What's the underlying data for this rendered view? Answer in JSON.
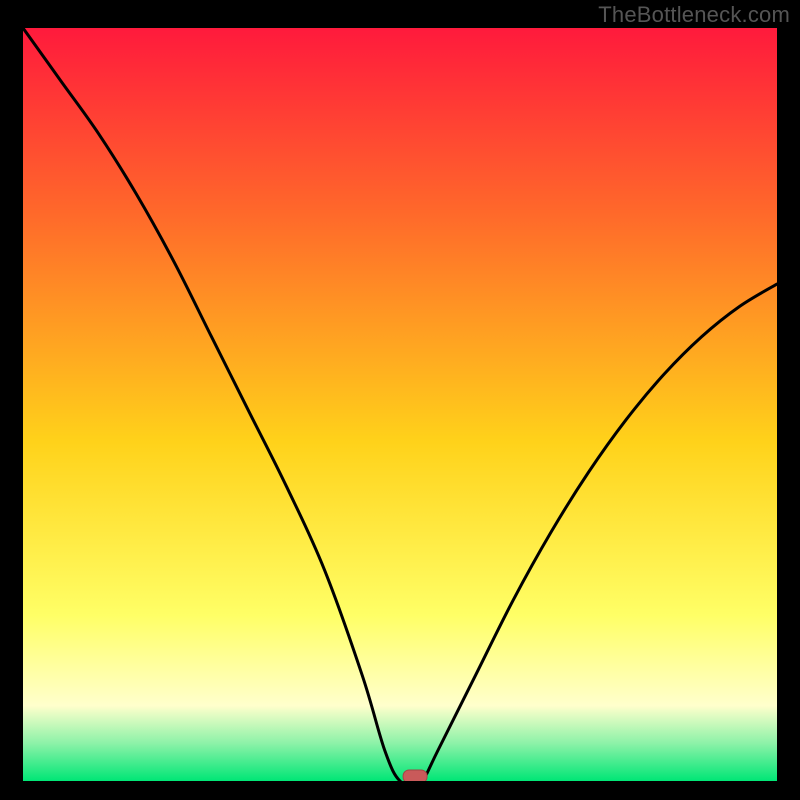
{
  "watermark": "TheBottleneck.com",
  "colors": {
    "frame": "#000000",
    "gradient_top": "#ff1a3c",
    "gradient_mid_upper": "#ff6a2a",
    "gradient_mid": "#ffd21a",
    "gradient_mid_lower": "#ffff66",
    "gradient_low_yellow": "#ffffcc",
    "gradient_low_green": "#8cf2a8",
    "gradient_bottom": "#00e676",
    "curve": "#000000",
    "marker_fill": "#c95a5a",
    "marker_stroke": "#a34545"
  },
  "chart_data": {
    "type": "line",
    "title": "",
    "xlabel": "",
    "ylabel": "",
    "xlim": [
      0,
      100
    ],
    "ylim": [
      0,
      100
    ],
    "grid": false,
    "series": [
      {
        "name": "bottleneck-curve",
        "x": [
          0,
          5,
          10,
          15,
          20,
          25,
          30,
          35,
          40,
          45,
          48,
          50,
          52,
          53,
          55,
          60,
          65,
          70,
          75,
          80,
          85,
          90,
          95,
          100
        ],
        "y": [
          100,
          93,
          86,
          78,
          69,
          59,
          49,
          39,
          28,
          14,
          4,
          0,
          0,
          0,
          4,
          14,
          24,
          33,
          41,
          48,
          54,
          59,
          63,
          66
        ]
      }
    ],
    "marker": {
      "name": "optimal-point",
      "x": 52,
      "y": 0
    },
    "background_gradient_stops": [
      {
        "pos": 0.0,
        "color": "#ff1a3c"
      },
      {
        "pos": 0.25,
        "color": "#ff6a2a"
      },
      {
        "pos": 0.55,
        "color": "#ffd21a"
      },
      {
        "pos": 0.78,
        "color": "#ffff66"
      },
      {
        "pos": 0.9,
        "color": "#ffffcc"
      },
      {
        "pos": 0.95,
        "color": "#8cf2a8"
      },
      {
        "pos": 1.0,
        "color": "#00e676"
      }
    ]
  }
}
